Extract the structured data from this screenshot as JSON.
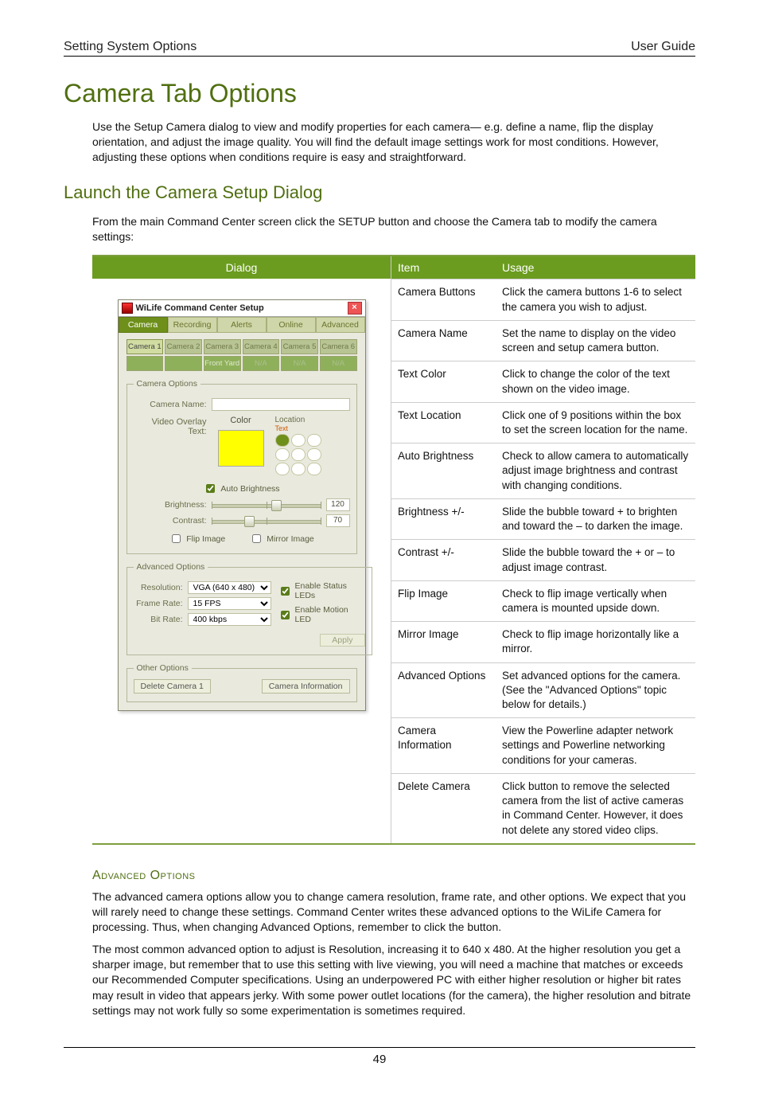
{
  "header": {
    "left": "Setting System Options",
    "right": "User Guide"
  },
  "title": "Camera Tab Options",
  "intro": "Use the Setup Camera dialog to view and modify properties for each camera— e.g. define a name, flip the display orientation, and adjust the image quality. You will find the default image settings work for most conditions. However, adjusting these options when conditions require is easy and straightforward.",
  "sub_title": "Launch the Camera Setup Dialog",
  "sub_intro_a": "From the main Command Center screen click the ",
  "sub_intro_setup": "SETUP",
  "sub_intro_b": " button and choose the Camera tab to modify the camera settings:",
  "col_headers": {
    "dialog": "Dialog",
    "item": "Item",
    "usage": "Usage"
  },
  "dialog": {
    "window_title": "WiLife Command Center Setup",
    "tabs": [
      "Camera",
      "Recording",
      "Alerts",
      "Online",
      "Advanced"
    ],
    "active_tab": 0,
    "camera_buttons": [
      "Camera 1",
      "Camera 2",
      "Camera 3",
      "Camera 4",
      "Camera 5",
      "Camera 6"
    ],
    "camera_subs": [
      "",
      "",
      "",
      "Front Yard",
      "N/A",
      "N/A"
    ],
    "camera_subs_row2_last": "N/A",
    "groups": {
      "camera_options": "Camera Options",
      "advanced_options": "Advanced Options",
      "other_options": "Other Options"
    },
    "labels": {
      "camera_name": "Camera Name:",
      "video_overlay": "Video Overlay Text:",
      "color": "Color",
      "location": "Location",
      "text_sample": "Text",
      "auto_brightness": "Auto Brightness",
      "brightness": "Brightness:",
      "contrast": "Contrast:",
      "flip_image": "Flip Image",
      "mirror_image": "Mirror Image",
      "resolution": "Resolution:",
      "frame_rate": "Frame Rate:",
      "bit_rate": "Bit Rate:",
      "enable_status_leds": "Enable Status LEDs",
      "enable_motion_led": "Enable Motion LED",
      "apply": "Apply",
      "delete_camera": "Delete Camera 1",
      "camera_information": "Camera Information"
    },
    "values": {
      "brightness": "120",
      "contrast": "70",
      "resolution": "VGA   (640 x 480)",
      "frame_rate": "15 FPS",
      "bit_rate": "400 kbps",
      "auto_brightness_checked": true,
      "flip_image_checked": false,
      "mirror_image_checked": false,
      "enable_status_leds_checked": true,
      "enable_motion_led_checked": true
    }
  },
  "options": [
    {
      "item": "Camera Buttons",
      "usage": "Click the camera buttons 1-6 to select the camera you wish to adjust."
    },
    {
      "item": "Camera Name",
      "usage": "Set the name to display on the video screen and setup camera button."
    },
    {
      "item": "Text Color",
      "usage": "Click to change the color of the text shown on the video image."
    },
    {
      "item": "Text Location",
      "usage": "Click one of 9 positions within the box to set the screen location for the name."
    },
    {
      "item": "Auto Brightness",
      "usage": "Check to allow camera to automatically adjust image brightness and contrast with changing conditions."
    },
    {
      "item": "Brightness +/-",
      "usage": "Slide the bubble toward + to brighten and toward the – to darken the image."
    },
    {
      "item": "Contrast +/-",
      "usage": "Slide the bubble toward the + or – to adjust image contrast."
    },
    {
      "item": "Flip Image",
      "usage": "Check to flip image vertically when camera is mounted upside down."
    },
    {
      "item": "Mirror Image",
      "usage": "Check to flip image horizontally like a mirror."
    },
    {
      "item": "Advanced Options",
      "usage": "Set advanced options for the camera. (See the \"Advanced Options\" topic below for details.)"
    },
    {
      "item": "Camera Information",
      "usage": "View the Powerline adapter network settings and Powerline networking conditions for your cameras."
    },
    {
      "item": "Delete Camera",
      "usage": "Click button to remove the selected camera from the list of active cameras in Command Center. However, it does not delete any stored video clips."
    }
  ],
  "advanced": {
    "heading": "Advanced Options",
    "para1_a": "The advanced camera options allow you to change camera resolution, frame rate, and other options. We expect that you will rarely need to change these settings. Command Center writes these advanced options to the WiLife Camera for processing. Thus, when changing Advanced Options, remember to click the ",
    "para1_b": " button.",
    "para2": "The most common advanced option to adjust is Resolution, increasing it to 640 x 480. At the higher resolution you get a sharper image, but remember that to use this setting with live viewing, you will need a machine that matches or exceeds our Recommended Computer specifications. Using an underpowered PC with either higher resolution or higher bit rates may result in video that appears jerky.  With some power outlet locations (for the camera), the higher resolution and bitrate settings may not work fully so some experimentation is sometimes required."
  },
  "page_number": "49"
}
